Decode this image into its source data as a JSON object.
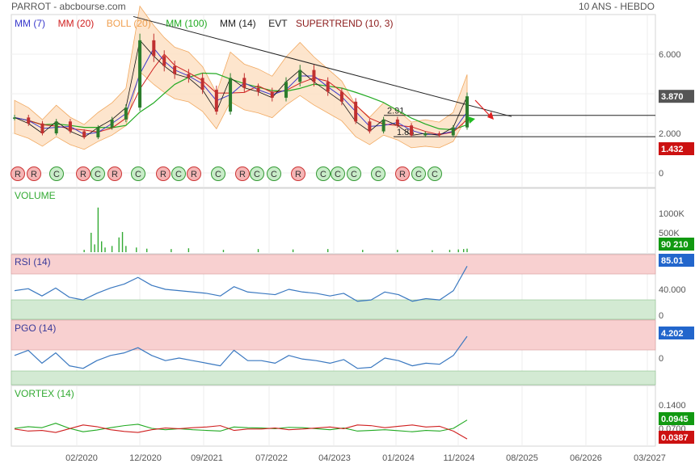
{
  "header": {
    "title": "PARROT - abcbourse.com",
    "period": "10 ANS - HEBDO"
  },
  "colors": {
    "mm7": "#3a3acc",
    "mm20": "#d02020",
    "boll": "#f0a050",
    "boll_fill": "#fde3c8",
    "mm100": "#22aa22",
    "mm14": "#222222",
    "evt": "#222222",
    "supertrend": "#8b1a1a",
    "price": "#2d7d2d",
    "volume": "#33aa33",
    "rsi_line": "#3a78c0",
    "overbought": "#f8d0d0",
    "oversold": "#d3ead3",
    "vortex_plus": "#22aa22",
    "vortex_minus": "#d02020",
    "badge_price": "#555555",
    "badge_red": "#cc1111",
    "badge_green": "#119911",
    "badge_blue": "#2266cc",
    "signal_r": "#f5b5b5",
    "signal_c": "#c8ecc8"
  },
  "chart_data": [
    {
      "type": "line",
      "panel": "price",
      "legend": [
        {
          "label": "MM (7)",
          "color": "#3a3acc"
        },
        {
          "label": "MM (20)",
          "color": "#d02020"
        },
        {
          "label": "BOLL (20)",
          "color": "#f0a050"
        },
        {
          "label": "MM (100)",
          "color": "#22aa22"
        },
        {
          "label": "MM (14)",
          "color": "#222222"
        },
        {
          "label": "EVT",
          "color": "#222222"
        },
        {
          "label": "SUPERTREND (10, 3)",
          "color": "#8b1a1a"
        }
      ],
      "ylim": [
        0,
        7.5
      ],
      "y_ticks": [
        {
          "v": 0,
          "label": "0"
        },
        {
          "v": 2,
          "label": "2.000"
        },
        {
          "v": 4,
          "label": "4.000"
        },
        {
          "v": 6,
          "label": "6.000"
        }
      ],
      "last_price": "3.870",
      "low_badge": "1.432",
      "levels": [
        {
          "value": 2.91,
          "label": "2.91"
        },
        {
          "value": 1.83,
          "label": "1.83"
        }
      ],
      "x": [
        0,
        8,
        16,
        24,
        32,
        40,
        48,
        56,
        64,
        72,
        80,
        86,
        92,
        100,
        108,
        116,
        124,
        132,
        140,
        148,
        156,
        164,
        172,
        180,
        188,
        196,
        204,
        212,
        220,
        228,
        236,
        244,
        252,
        260
      ],
      "values": [
        2.8,
        2.5,
        2.0,
        2.6,
        2.1,
        1.8,
        2.3,
        2.7,
        3.3,
        6.7,
        5.9,
        5.4,
        5.0,
        4.8,
        4.2,
        3.1,
        4.8,
        4.3,
        4.1,
        3.8,
        4.6,
        5.2,
        4.6,
        4.1,
        3.6,
        2.6,
        2.1,
        2.7,
        2.4,
        1.9,
        2.0,
        1.9,
        2.3,
        3.87
      ],
      "signals": [
        "R",
        "R",
        "C",
        "R",
        "C",
        "R",
        "C",
        "R",
        "C",
        "R",
        "C",
        "R",
        "C",
        "C",
        "R",
        "C",
        "C",
        "C",
        "C",
        "R",
        "C",
        "C"
      ]
    },
    {
      "type": "bar",
      "panel": "volume",
      "title": "VOLUME",
      "y_ticks": [
        {
          "v": 500000,
          "label": "500K"
        },
        {
          "v": 1000000,
          "label": "1000K"
        }
      ],
      "last_value": "90 210",
      "x": [
        40,
        44,
        46,
        48,
        50,
        52,
        56,
        60,
        62,
        64,
        70,
        76,
        90,
        100,
        120,
        140,
        160,
        180,
        200,
        220,
        240,
        250,
        255,
        258,
        260
      ],
      "values": [
        60000,
        500000,
        200000,
        1150000,
        280000,
        120000,
        160000,
        380000,
        520000,
        160000,
        120000,
        90000,
        80000,
        100000,
        60000,
        80000,
        70000,
        80000,
        60000,
        60000,
        50000,
        60000,
        70000,
        80000,
        90210
      ]
    },
    {
      "type": "line",
      "panel": "rsi",
      "title": "RSI (14)",
      "y_ticks": [
        {
          "v": 0,
          "label": "0"
        },
        {
          "v": 40,
          "label": "40.000"
        }
      ],
      "last_value": "85.01",
      "values": [
        48,
        51,
        40,
        52,
        38,
        34,
        44,
        52,
        58,
        68,
        56,
        50,
        48,
        46,
        44,
        40,
        54,
        46,
        44,
        42,
        50,
        46,
        44,
        40,
        44,
        32,
        34,
        46,
        42,
        32,
        36,
        34,
        48,
        85
      ]
    },
    {
      "type": "line",
      "panel": "pgo",
      "title": "PGO (14)",
      "y_ticks": [
        {
          "v": 0,
          "label": "0"
        }
      ],
      "last_value": "4.202",
      "values": [
        0.5,
        1.5,
        -1.0,
        1.0,
        -1.5,
        -2.0,
        -0.5,
        0.5,
        1.0,
        2.0,
        0.5,
        -0.5,
        0.0,
        -0.5,
        -1.0,
        -1.5,
        1.5,
        -0.5,
        -0.5,
        -1.0,
        0.5,
        -0.2,
        -0.5,
        -1.0,
        -0.3,
        -2.0,
        -1.8,
        0.0,
        -0.5,
        -1.5,
        -1.0,
        -1.2,
        0.5,
        4.2
      ]
    },
    {
      "type": "line",
      "panel": "vortex",
      "title": "VORTEX (14)",
      "y_ticks": [
        {
          "v": 0.14,
          "label": "0.1400"
        },
        {
          "v": 0.07,
          "label": "0.0700"
        }
      ],
      "last_values": {
        "plus": "0.0945",
        "minus": "0.0387"
      },
      "series": [
        {
          "values": [
            0.07,
            0.075,
            0.072,
            0.085,
            0.07,
            0.06,
            0.065,
            0.072,
            0.078,
            0.082,
            0.07,
            0.066,
            0.069,
            0.066,
            0.064,
            0.062,
            0.074,
            0.072,
            0.071,
            0.069,
            0.073,
            0.072,
            0.069,
            0.066,
            0.071,
            0.062,
            0.064,
            0.066,
            0.063,
            0.06,
            0.064,
            0.062,
            0.07,
            0.0945
          ]
        },
        {
          "values": [
            0.068,
            0.062,
            0.064,
            0.058,
            0.069,
            0.08,
            0.075,
            0.066,
            0.061,
            0.058,
            0.066,
            0.071,
            0.069,
            0.072,
            0.074,
            0.078,
            0.064,
            0.068,
            0.068,
            0.071,
            0.066,
            0.068,
            0.071,
            0.074,
            0.069,
            0.08,
            0.078,
            0.072,
            0.076,
            0.08,
            0.074,
            0.076,
            0.062,
            0.0387
          ]
        }
      ]
    }
  ],
  "x_axis": {
    "labels": [
      "02/2020",
      "12/2020",
      "09/2021",
      "07/2022",
      "04/2023",
      "01/2024",
      "11/2024",
      "08/2025",
      "06/2026",
      "03/2027"
    ]
  }
}
